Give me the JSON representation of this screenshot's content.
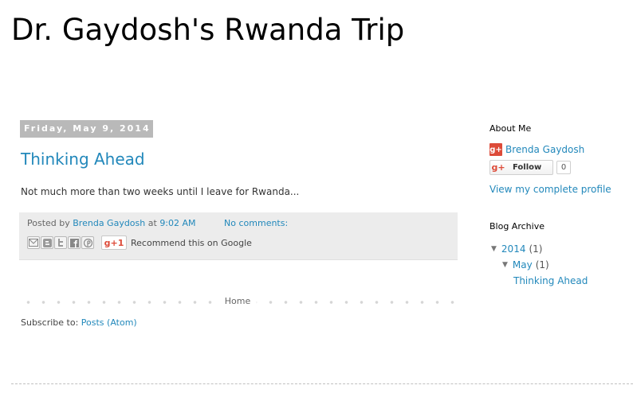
{
  "blog": {
    "title": "Dr. Gaydosh's Rwanda Trip"
  },
  "post": {
    "date": "Friday, May 9, 2014",
    "title": "Thinking Ahead",
    "body": "Not much more than two weeks until I leave for Rwanda...",
    "footer": {
      "posted_by_label": "Posted by",
      "author": "Brenda Gaydosh",
      "at_label": "at",
      "time": "9:02 AM",
      "comments": "No comments:",
      "gplus_label": "+1",
      "recommend": "Recommend this on Google"
    },
    "share_icons": [
      "email-icon",
      "blogger-icon",
      "twitter-icon",
      "facebook-icon",
      "pinterest-icon"
    ]
  },
  "pager": {
    "home": "Home"
  },
  "subscribe": {
    "label": "Subscribe to:",
    "link": "Posts (Atom)"
  },
  "sidebar": {
    "about": {
      "title": "About Me",
      "name": "Brenda Gaydosh",
      "follow_label": "Follow",
      "follow_count": "0",
      "profile_link": "View my complete profile"
    },
    "archive": {
      "title": "Blog Archive",
      "year": {
        "label": "2014",
        "count": "(1)"
      },
      "month": {
        "label": "May",
        "count": "(1)"
      },
      "post": "Thinking Ahead"
    }
  },
  "colors": {
    "link": "#2288bb",
    "date_header_bg": "#b9b9b9",
    "footer_bg": "#ececec",
    "gplus_red": "#dd4b39"
  }
}
